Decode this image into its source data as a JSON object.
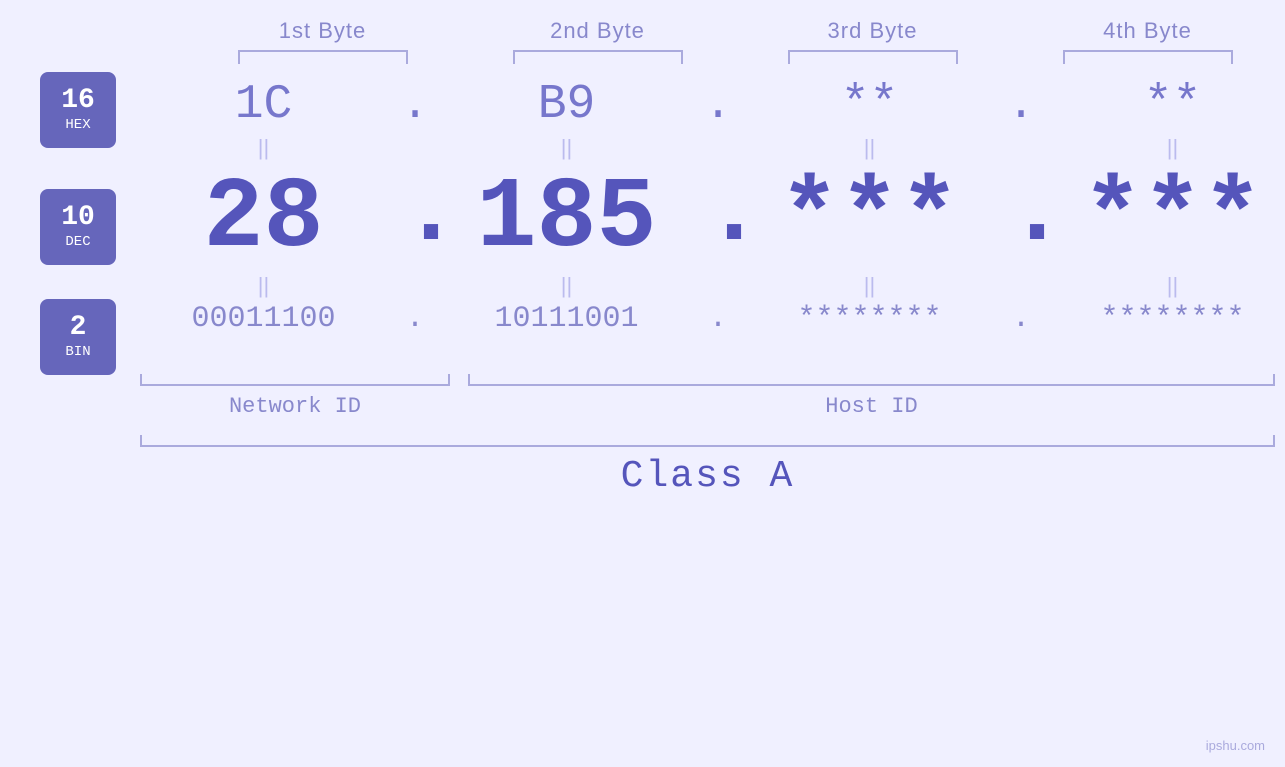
{
  "page": {
    "background_color": "#f0f0ff",
    "watermark": "ipshu.com"
  },
  "byte_headers": [
    "1st Byte",
    "2nd Byte",
    "3rd Byte",
    "4th Byte"
  ],
  "badges": [
    {
      "number": "16",
      "label": "HEX"
    },
    {
      "number": "10",
      "label": "DEC"
    },
    {
      "number": "2",
      "label": "BIN"
    }
  ],
  "hex_values": [
    "1C",
    "B9",
    "**",
    "**"
  ],
  "dec_values": [
    "28",
    "185",
    "***",
    "***"
  ],
  "bin_values": [
    "00011100",
    "10111001",
    "********",
    "********"
  ],
  "dots": [
    ".",
    ".",
    ".",
    ""
  ],
  "equals_sign": "||",
  "network_id_label": "Network ID",
  "host_id_label": "Host ID",
  "class_label": "Class A"
}
